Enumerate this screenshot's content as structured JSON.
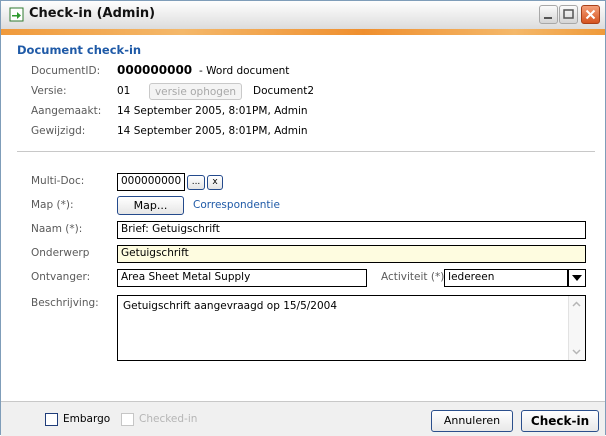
{
  "window": {
    "title": "Check-in (Admin)",
    "section_title": "Document check-in"
  },
  "info": {
    "document_id_label": "DocumentID:",
    "document_id": "000000000",
    "document_type": "- Word document",
    "versie_label": "Versie:",
    "versie": "01",
    "versie_button": "versie ophogen",
    "document_name": "Document2",
    "aangemaakt_label": "Aangemaakt:",
    "aangemaakt": "14 September 2005,  8:01PM, Admin",
    "gewijzigd_label": "Gewijzigd:",
    "gewijzigd": "14 September 2005,  8:01PM, Admin"
  },
  "form": {
    "multidoc_label": "Multi-Doc:",
    "multidoc_value": "000000000",
    "multidoc_browse": "...",
    "multidoc_clear": "x",
    "map_label": "Map (*):",
    "map_button": "Map...",
    "map_value": "Correspondentie",
    "naam_label": "Naam (*):",
    "naam_value": "Brief: Getuigschrift",
    "onderwerp_label": "Onderwerp",
    "onderwerp_value": "Getuigschrift",
    "ontvanger_label": "Ontvanger:",
    "ontvanger_value": "Area Sheet Metal Supply",
    "activiteit_label": "Activiteit (*):",
    "activiteit_value": "Iedereen",
    "beschrijving_label": "Beschrijving:",
    "beschrijving_value": "Getuigschrift aangevraagd op 15/5/2004"
  },
  "footer": {
    "embargo_label": "Embargo",
    "checked_in_label": "Checked-in",
    "cancel_button": "Annuleren",
    "checkin_button": "Check-in"
  },
  "colors": {
    "accent": "#1f5aa7",
    "yellow_field": "#fefce0",
    "close_button": "#d5531f",
    "title_strip": "#f09a3c"
  }
}
